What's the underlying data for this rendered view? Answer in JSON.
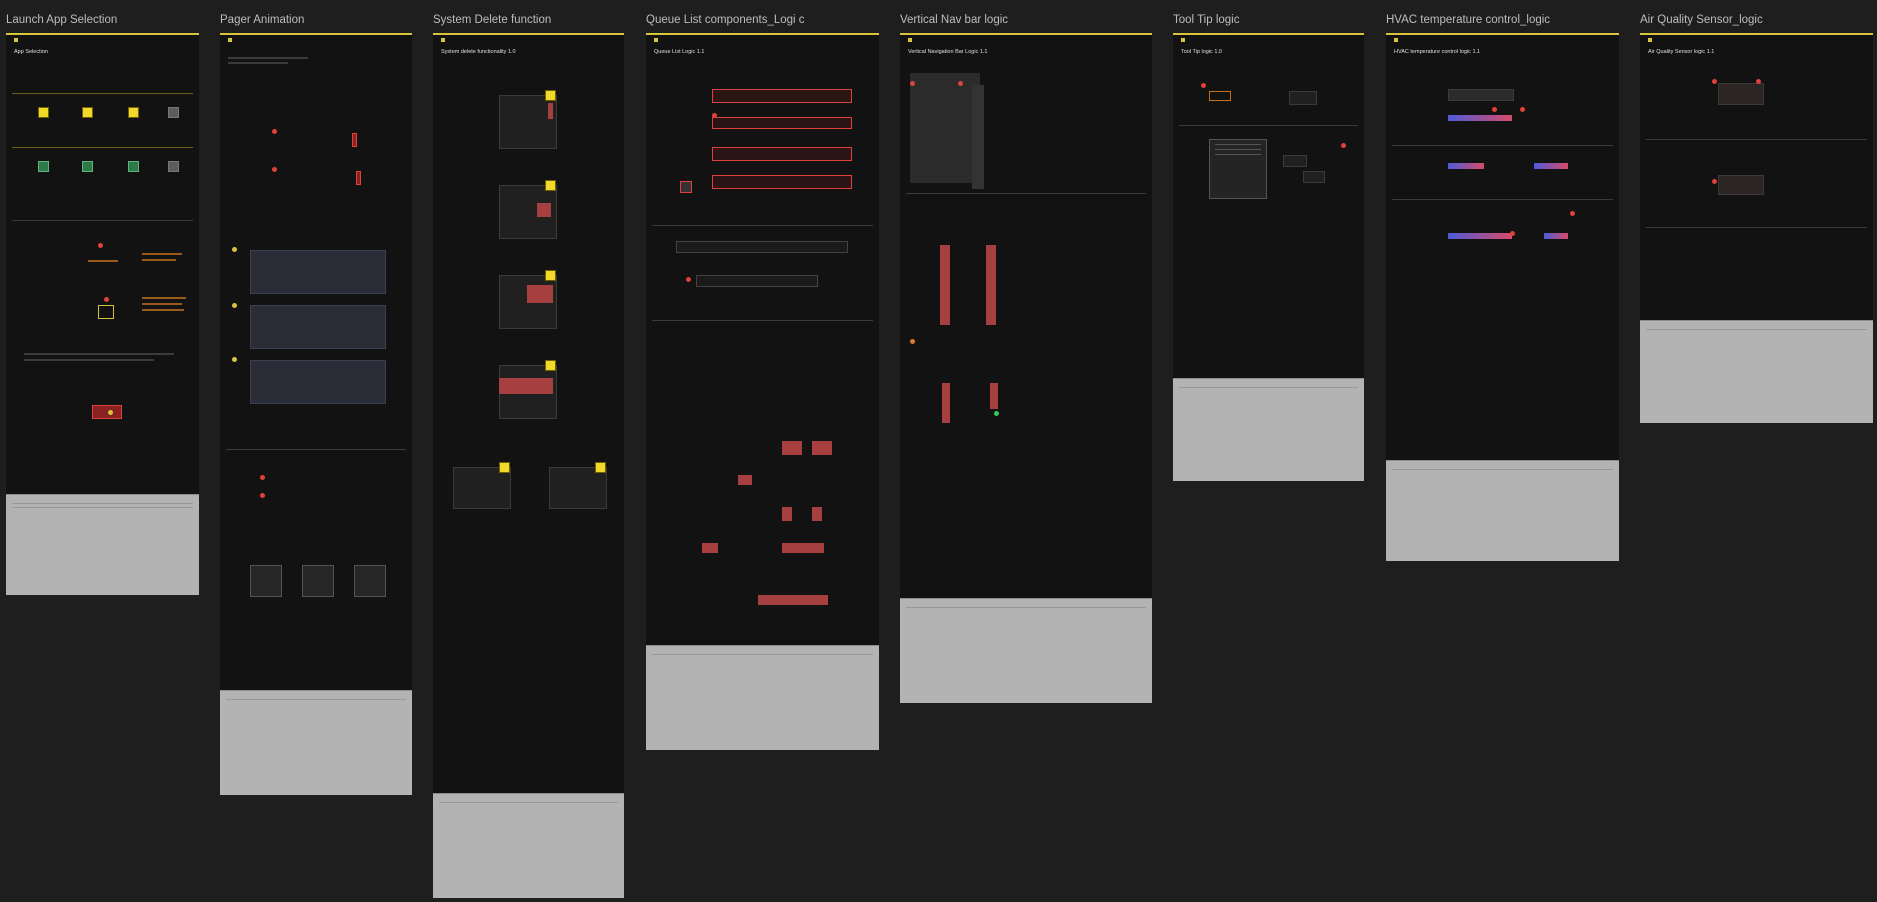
{
  "canvas": {
    "frames": [
      {
        "id": "launch",
        "title": "Launch App Selection",
        "page_title": "App Selection"
      },
      {
        "id": "pager",
        "title": "Pager Animation"
      },
      {
        "id": "sysdel",
        "title": "System Delete function",
        "page_title": "System delete functionality 1.0"
      },
      {
        "id": "queue",
        "title": "Queue List components_Logi c",
        "page_title": "Queue List Logic 1.1"
      },
      {
        "id": "vnav",
        "title": "Vertical Nav bar logic",
        "page_title": "Vertical Navigation Bar Logic 1.1"
      },
      {
        "id": "tooltip",
        "title": "Tool Tip logic",
        "page_title": "Tool Tip logic 1.0"
      },
      {
        "id": "hvac",
        "title": "HVAC temperature control_logic",
        "page_title": "HVAC temperature control logic 1.1"
      },
      {
        "id": "airq",
        "title": "Air Quality Sensor_logic",
        "page_title": "Air Quality Sensor logic 1.1"
      }
    ]
  },
  "colors": {
    "canvas": "#1e1e1e",
    "frame": "#121212",
    "accent": "#d8c43a",
    "marker": "#e0413a",
    "footer": "#b3b3b3"
  }
}
